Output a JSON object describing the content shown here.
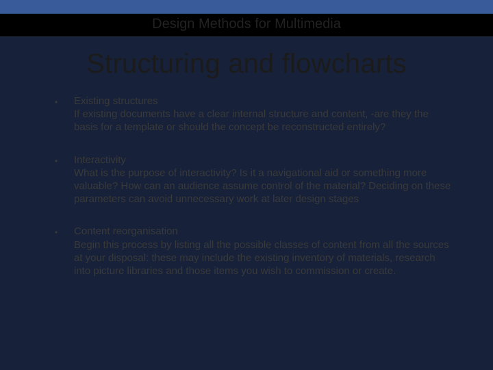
{
  "header": {
    "course_title": "Design Methods for Multimedia"
  },
  "slide": {
    "title": "Structuring and flowcharts"
  },
  "bullets": [
    {
      "title": "Existing structures",
      "description": "If existing documents have a clear internal structure and content, -are they the basis for a template or should the concept be reconstructed entirely?"
    },
    {
      "title": "Interactivity",
      "description": "What is the purpose of interactivity? Is it a navigational aid or something more valuable? How can an audience assume control of the material? Deciding on these parameters can avoid unnecessary work at later design stages"
    },
    {
      "title": "Content reorganisation",
      "description": "Begin this process by listing all the possible classes of content from all the sources at your disposal: these may include the existing inventory of materials, research into picture libraries and those items you wish to commission or create."
    }
  ]
}
